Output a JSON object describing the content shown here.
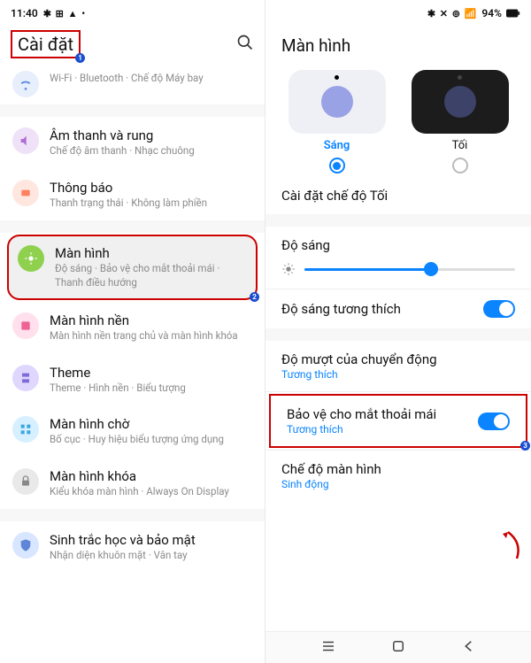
{
  "status": {
    "time": "11:40",
    "right": "94%"
  },
  "left": {
    "title": "Cài đặt",
    "items": {
      "connections": {
        "sub": "Wi-Fi · Bluetooth · Chế độ Máy bay"
      },
      "sound": {
        "title": "Âm thanh và rung",
        "sub": "Chế độ âm thanh · Nhạc chuông"
      },
      "notify": {
        "title": "Thông báo",
        "sub": "Thanh trạng thái · Không làm phiền"
      },
      "display": {
        "title": "Màn hình",
        "sub": "Độ sáng · Bảo vệ cho mắt thoải mái · Thanh điều hướng"
      },
      "wallpaper": {
        "title": "Màn hình nền",
        "sub": "Màn hình nền trang chủ và màn hình khóa"
      },
      "theme": {
        "title": "Theme",
        "sub": "Theme · Hình nền · Biểu tượng"
      },
      "home": {
        "title": "Màn hình chờ",
        "sub": "Bố cục · Huy hiệu biểu tượng ứng dụng"
      },
      "lock": {
        "title": "Màn hình khóa",
        "sub": "Kiểu khóa màn hình · Always On Display"
      },
      "bio": {
        "title": "Sinh trắc học và bảo mật",
        "sub": "Nhận diện khuôn mặt · Vân tay"
      }
    }
  },
  "right": {
    "title": "Màn hình",
    "theme": {
      "light": "Sáng",
      "dark": "Tối"
    },
    "dark_settings": "Cài đặt chế độ Tối",
    "brightness": "Độ sáng",
    "adaptive": "Độ sáng tương thích",
    "motion": {
      "t": "Độ mượt của chuyển động",
      "s": "Tương thích"
    },
    "eye": {
      "t": "Bảo vệ cho mắt thoải mái",
      "s": "Tương thích"
    },
    "mode": {
      "t": "Chế độ màn hình",
      "s": "Sinh động"
    }
  },
  "badges": {
    "b1": "1",
    "b2": "2",
    "b3": "3"
  }
}
